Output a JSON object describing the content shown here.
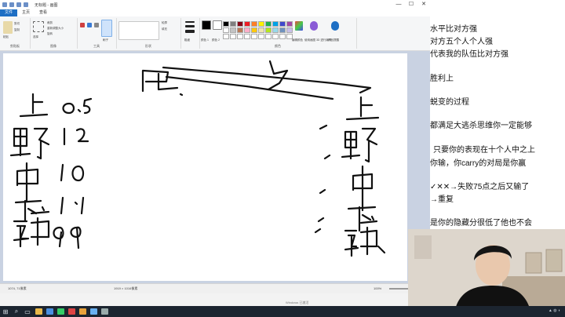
{
  "window": {
    "title": "无标题 - 画图",
    "controls": [
      "—",
      "☐",
      "✕"
    ]
  },
  "menu": {
    "file": "文件",
    "tabs": [
      "主页",
      "查看"
    ]
  },
  "ribbon": {
    "groups": [
      "剪贴板",
      "图像",
      "工具",
      "形状",
      "颜色"
    ],
    "buttons": [
      "粘贴",
      "剪切",
      "复制",
      "选择",
      "裁剪",
      "重新调整大小",
      "旋转",
      "刷子",
      "轮廓",
      "填充",
      "粗细",
      "颜色 1",
      "颜色 2",
      "编辑颜色",
      "使用画图 3D 进行编辑",
      "产品提醒"
    ],
    "palette": [
      "#000000",
      "#7f7f7f",
      "#880015",
      "#ed1c24",
      "#ff7f27",
      "#fff200",
      "#22b14c",
      "#00a2e8",
      "#3f48cc",
      "#a349a4",
      "#ffffff",
      "#c3c3c3",
      "#b97a57",
      "#ffaec9",
      "#ffc90e",
      "#efe4b0",
      "#b5e61d",
      "#99d9ea",
      "#7092be",
      "#c8bfe7",
      "#ffffff",
      "#ffffff",
      "#ffffff",
      "#ffffff",
      "#ffffff",
      "#ffffff",
      "#ffffff",
      "#ffffff",
      "#ffffff",
      "#ffffff"
    ],
    "color1": "#000000",
    "color2": "#ffffff"
  },
  "statusbar": {
    "position": "1074, 71像素",
    "canvas_size": "1919 × 1016像素",
    "zoom": "100%"
  },
  "notice": "Windows 已激活",
  "overlay_lines": [
    "水平比对方强",
    "对方五个人个人强",
    "代表我的队伍比对方强",
    "胜利上",
    "蜕变的过程",
    "都满足大逃杀思维你一定能够",
    "只要你的表现在十个人中之上",
    "你输，你carry的对局是你赢",
    "✓✕✕→失败75点之后又输了",
    "→重复",
    "是你的隐藏分很低了他也不会"
  ]
}
